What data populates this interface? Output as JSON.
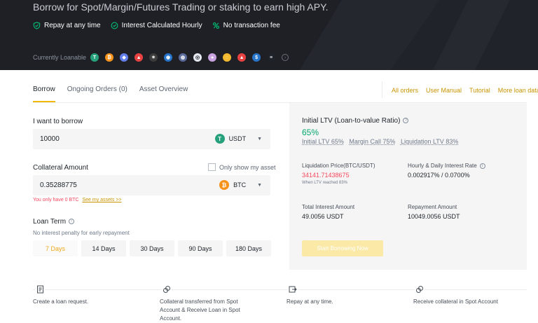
{
  "hero": {
    "title": "Borrow for Spot/Margin/Futures Trading or staking to earn high APY.",
    "features": [
      {
        "label": "Repay at any time",
        "icon": "shield-check-icon"
      },
      {
        "label": "Interest Calculated Hourly",
        "icon": "check-circle-icon"
      },
      {
        "label": "No transaction fee",
        "icon": "percent-icon"
      }
    ],
    "loanable_label": "Currently Loanable",
    "coins": [
      {
        "icon": "usdt-coin-icon",
        "color": "#26a17b",
        "glyph": "T"
      },
      {
        "icon": "btc-coin-icon",
        "color": "#f7931a",
        "glyph": "₿"
      },
      {
        "icon": "coin-icon-3",
        "color": "#627eea",
        "glyph": "◆"
      },
      {
        "icon": "coin-icon-4",
        "color": "#e84142",
        "glyph": "▲"
      },
      {
        "icon": "coin-icon-5",
        "color": "#3c3c3d",
        "glyph": "✶"
      },
      {
        "icon": "coin-icon-6",
        "color": "#2775ca",
        "glyph": "◉"
      },
      {
        "icon": "coin-icon-7",
        "color": "#5b6b9c",
        "glyph": "◍"
      },
      {
        "icon": "coin-icon-8",
        "color": "#e6e9ef",
        "glyph": "◎"
      },
      {
        "icon": "coin-icon-9",
        "color": "#c9a3e0",
        "glyph": "●"
      },
      {
        "icon": "coin-icon-10",
        "color": "#f3ba2f",
        "glyph": "◌"
      },
      {
        "icon": "coin-icon-11",
        "color": "#e84142",
        "glyph": "▲"
      },
      {
        "icon": "coin-icon-12",
        "color": "#2775ca",
        "glyph": "$"
      },
      {
        "icon": "coin-icon-13",
        "color": "#1e2329",
        "glyph": "≡"
      }
    ]
  },
  "tabs": [
    {
      "label": "Borrow",
      "active": true
    },
    {
      "label": "Ongoing Orders (0)",
      "active": false
    },
    {
      "label": "Asset Overview",
      "active": false
    }
  ],
  "links": [
    "All orders",
    "User Manual",
    "Tutorial",
    "More loan data"
  ],
  "form": {
    "borrow_label": "I want to borrow",
    "borrow_value": "10000",
    "borrow_asset": "USDT",
    "collateral_label": "Collateral Amount",
    "only_show_label": "Only show my asset",
    "collateral_value": "0.35288775",
    "collateral_asset": "BTC",
    "warning": "You only have 0 BTC",
    "warning_link": "See my assets >>",
    "loan_term_label": "Loan Term",
    "loan_term_note": "No interest penalty for early repayment",
    "terms": [
      {
        "label": "7 Days",
        "selected": true
      },
      {
        "label": "14 Days",
        "selected": false
      },
      {
        "label": "30 Days",
        "selected": false
      },
      {
        "label": "90 Days",
        "selected": false
      },
      {
        "label": "180 Days",
        "selected": false
      }
    ]
  },
  "panel": {
    "ltv_title": "Initial LTV (Loan-to-value Ratio)",
    "ltv_value": "65%",
    "initial_ltv": "Initial LTV 65%",
    "margin_call": "Margin Call 75%",
    "liquidation_ltv": "Liquidation LTV 83%",
    "liq_price_label": "Liquidation Price(BTC/USDT)",
    "liq_price_value": "34141.71438675",
    "liq_note": "When LTV reached 83%",
    "rate_label": "Hourly & Daily Interest Rate",
    "rate_value": "0.002917% / 0.0700%",
    "total_interest_label": "Total Interest Amount",
    "total_interest_value": "49.0056 USDT",
    "repayment_label": "Repayment Amount",
    "repayment_value": "10049.0056 USDT",
    "start_button": "Start Borrowing Now"
  },
  "steps": [
    {
      "icon": "document-icon",
      "text": "Create a loan request."
    },
    {
      "icon": "link-icon",
      "text": "Collateral transferred from Spot Account & Receive Loan in Spot Account."
    },
    {
      "icon": "repay-icon",
      "text": "Repay at any time."
    },
    {
      "icon": "link-icon",
      "text": "Receive collateral in Spot Account"
    }
  ],
  "colors": {
    "accent": "#f0b90b",
    "link": "#c99400",
    "positive": "#03a66d",
    "negative": "#f6465d",
    "hero_bg": "#1e2026"
  }
}
